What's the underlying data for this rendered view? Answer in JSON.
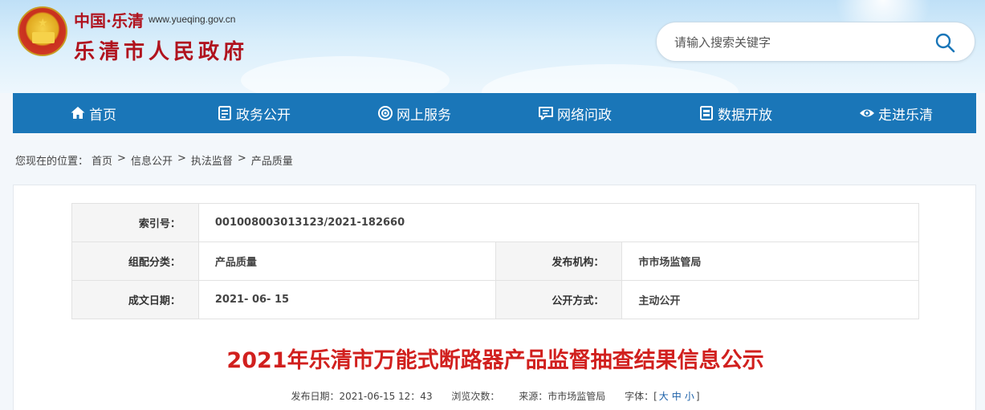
{
  "header": {
    "logo_top_text": "中国·乐清",
    "logo_url": "www.yueqing.gov.cn",
    "site_name": "乐清市人民政府"
  },
  "search": {
    "placeholder": "请输入搜索关键字"
  },
  "nav": {
    "items": [
      {
        "label": "首页",
        "icon": "home-icon"
      },
      {
        "label": "政务公开",
        "icon": "document-icon"
      },
      {
        "label": "网上服务",
        "icon": "service-icon"
      },
      {
        "label": "网络问政",
        "icon": "chat-icon"
      },
      {
        "label": "数据开放",
        "icon": "data-icon"
      },
      {
        "label": "走进乐清",
        "icon": "eye-icon"
      }
    ],
    "color": "#1a76b8"
  },
  "breadcrumb": {
    "prefix": "您现在的位置：",
    "items": [
      "首页",
      "信息公开",
      "执法监督",
      "产品质量"
    ]
  },
  "meta": {
    "index_label": "索引号：",
    "index_value": "001008003013123/2021-182660",
    "category_label": "组配分类：",
    "category_value": "产品质量",
    "publisher_label": "发布机构：",
    "publisher_value": "市市场监管局",
    "date_label": "成文日期：",
    "date_value": "2021- 06- 15",
    "method_label": "公开方式：",
    "method_value": "主动公开"
  },
  "article": {
    "title": "2021年乐清市万能式断路器产品监督抽查结果信息公示",
    "publish_date": "发布日期：2021-06-15 12：43",
    "views": "浏览次数：",
    "source": "来源：市市场监管局",
    "font_label": "字体：[",
    "font_large": "大",
    "font_medium": "中",
    "font_small": "小",
    "font_close": "]"
  },
  "colors": {
    "title_red": "#d1201e",
    "brand_red": "#b0131e"
  }
}
